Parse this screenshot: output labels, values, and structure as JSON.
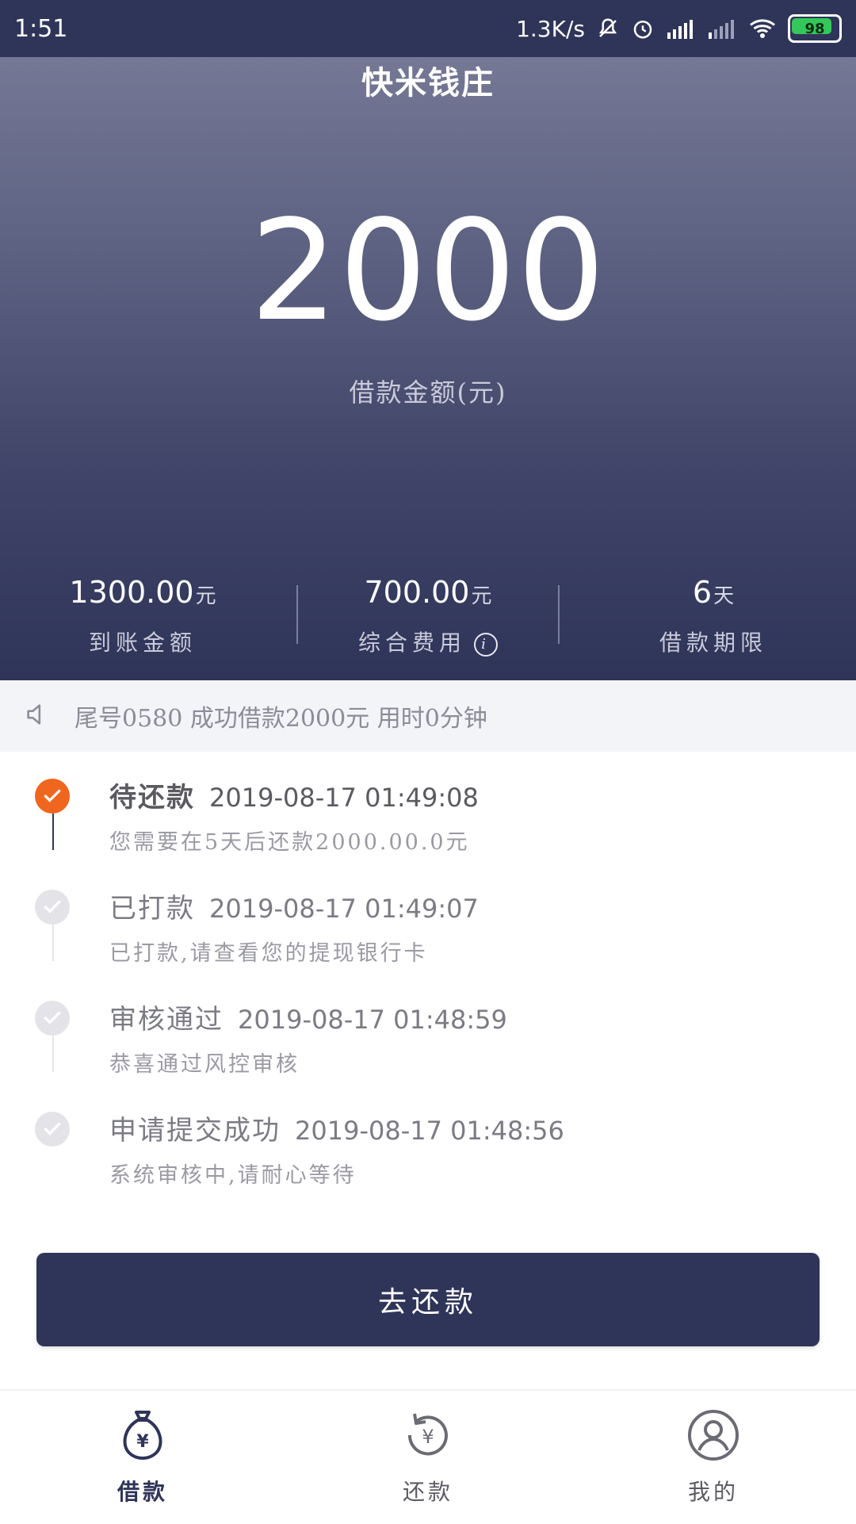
{
  "status_bar": {
    "time": "1:51",
    "network_speed": "1.3K/s",
    "battery": "98"
  },
  "app": {
    "title": "快米钱庄"
  },
  "loan": {
    "amount": "2000",
    "amount_label": "借款金额(元)"
  },
  "stats": [
    {
      "value": "1300.00",
      "unit": "元",
      "label": "到账金额"
    },
    {
      "value": "700.00",
      "unit": "元",
      "label": "综合费用"
    },
    {
      "value": "6",
      "unit": "天",
      "label": "借款期限"
    }
  ],
  "notice": {
    "text": "尾号0580 成功借款2000元 用时0分钟"
  },
  "timeline": [
    {
      "title": "待还款",
      "time": "2019-08-17 01:49:08",
      "desc": "您需要在5天后还款2000.00.0元",
      "state": "active"
    },
    {
      "title": "已打款",
      "time": "2019-08-17 01:49:07",
      "desc": "已打款,请查看您的提现银行卡",
      "state": "done"
    },
    {
      "title": "审核通过",
      "time": "2019-08-17 01:48:59",
      "desc": "恭喜通过风控审核",
      "state": "done"
    },
    {
      "title": "申请提交成功",
      "time": "2019-08-17 01:48:56",
      "desc": "系统审核中,请耐心等待",
      "state": "done"
    }
  ],
  "cta": {
    "label": "去还款"
  },
  "bottom_nav": [
    {
      "label": "借款",
      "icon": "money-bag-icon",
      "active": true
    },
    {
      "label": "还款",
      "icon": "repay-icon",
      "active": false
    },
    {
      "label": "我的",
      "icon": "profile-icon",
      "active": false
    }
  ],
  "colors": {
    "primary": "#2f3459",
    "accent": "#f0661e",
    "notice_bg": "#f2f4f8"
  }
}
